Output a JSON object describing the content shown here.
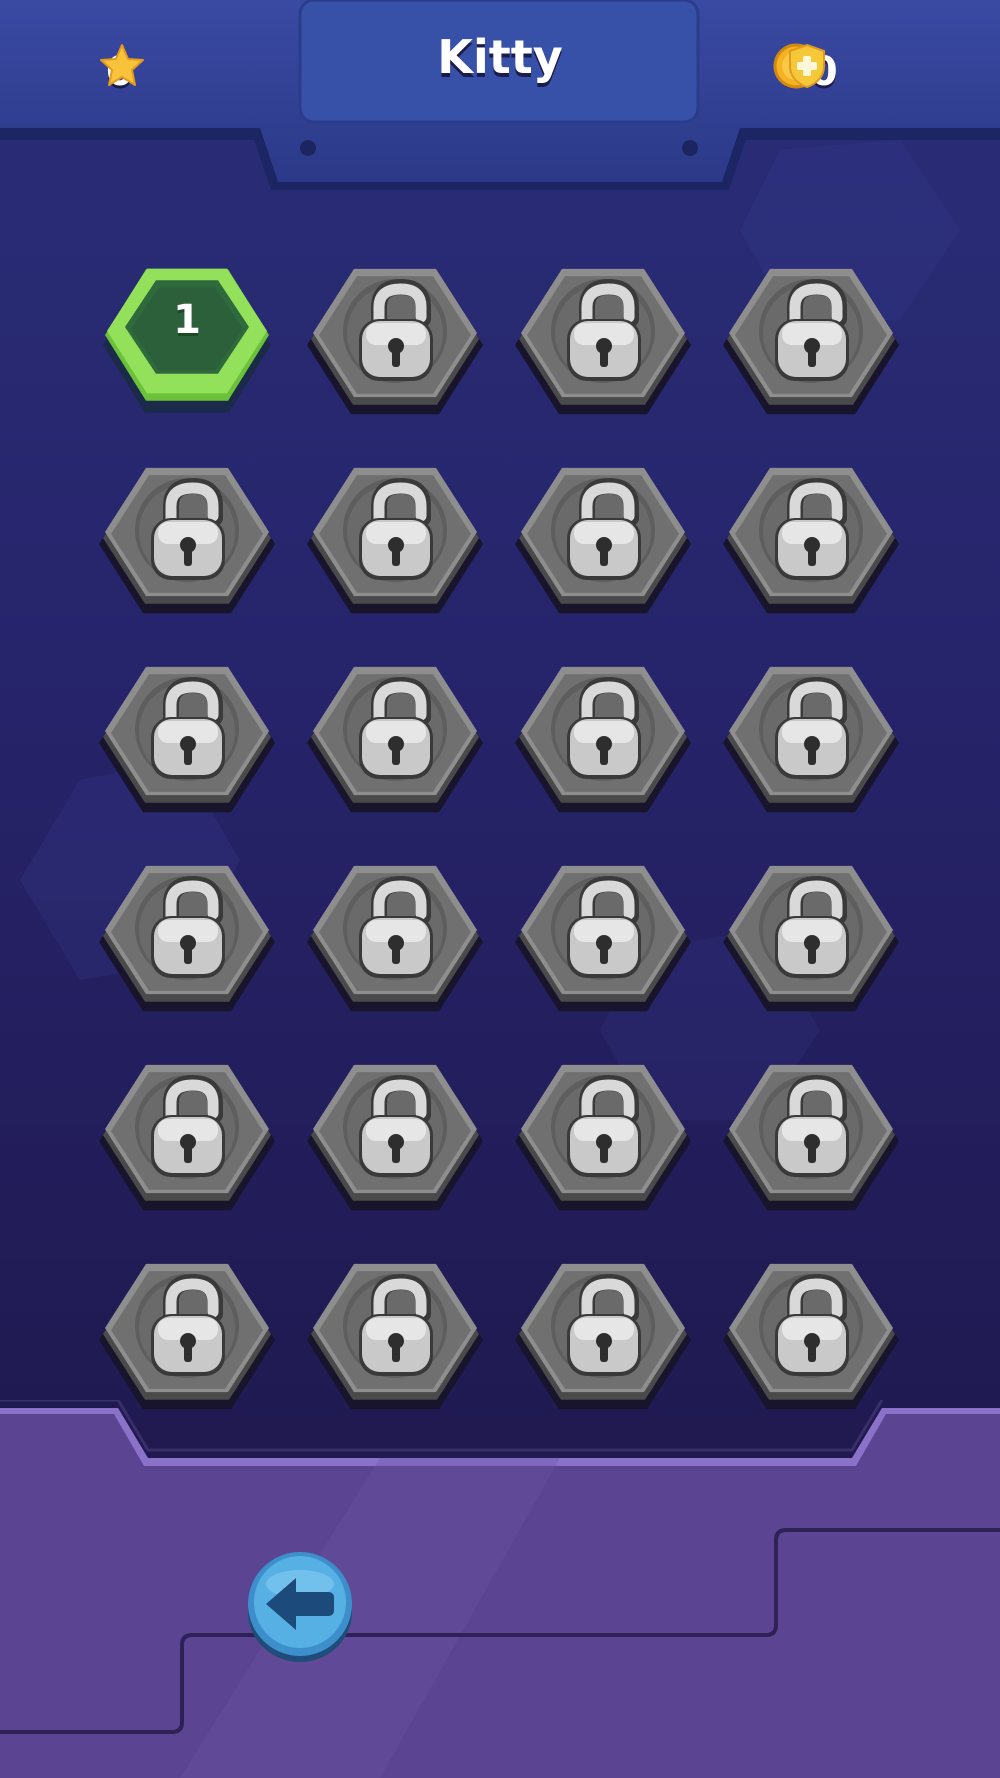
{
  "header": {
    "title": "Kitty",
    "stars": "0",
    "coins": "50",
    "star_icon": "star-icon",
    "coin_icon": "coin-icon",
    "shield_icon": "shield-plus-icon"
  },
  "levels": [
    {
      "label": "1",
      "locked": false
    },
    {
      "label": "",
      "locked": true
    },
    {
      "label": "",
      "locked": true
    },
    {
      "label": "",
      "locked": true
    },
    {
      "label": "",
      "locked": true
    },
    {
      "label": "",
      "locked": true
    },
    {
      "label": "",
      "locked": true
    },
    {
      "label": "",
      "locked": true
    },
    {
      "label": "",
      "locked": true
    },
    {
      "label": "",
      "locked": true
    },
    {
      "label": "",
      "locked": true
    },
    {
      "label": "",
      "locked": true
    },
    {
      "label": "",
      "locked": true
    },
    {
      "label": "",
      "locked": true
    },
    {
      "label": "",
      "locked": true
    },
    {
      "label": "",
      "locked": true
    },
    {
      "label": "",
      "locked": true
    },
    {
      "label": "",
      "locked": true
    },
    {
      "label": "",
      "locked": true
    },
    {
      "label": "",
      "locked": true
    },
    {
      "label": "",
      "locked": true
    },
    {
      "label": "",
      "locked": true
    },
    {
      "label": "",
      "locked": true
    },
    {
      "label": "",
      "locked": true
    }
  ],
  "footer": {
    "back_icon": "arrow-left-icon"
  },
  "colors": {
    "unlocked_fill": "#2f6a3c",
    "unlocked_rim": "#7fd34d",
    "locked_fill": "#6b6b6b",
    "footer_purple": "#5a438f",
    "back_button": "#4fa3d8"
  }
}
